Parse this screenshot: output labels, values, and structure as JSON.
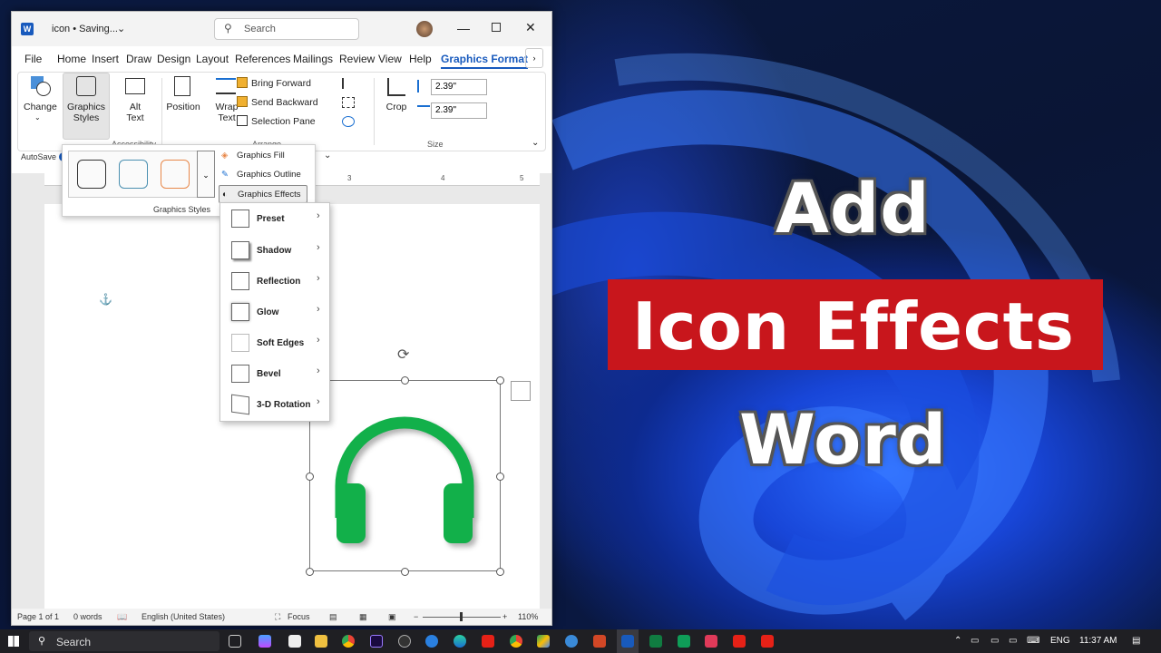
{
  "window": {
    "title": "icon • Saving...",
    "search_placeholder": "Search"
  },
  "tabs": [
    "File",
    "Home",
    "Insert",
    "Draw",
    "Design",
    "Layout",
    "References",
    "Mailings",
    "Review",
    "View",
    "Help",
    "Graphics Format"
  ],
  "ribbon": {
    "change": "Change",
    "graphics_styles": "Graphics Styles",
    "alt_text": "Alt Text",
    "accessibility": "Accessibility",
    "position": "Position",
    "wrap_text": "Wrap Text",
    "bring_forward": "Bring Forward",
    "send_backward": "Send Backward",
    "selection_pane": "Selection Pane",
    "arrange": "Arrange",
    "crop": "Crop",
    "height": "2.39\"",
    "width": "2.39\"",
    "size": "Size"
  },
  "qat": {
    "autosave": "AutoSave"
  },
  "gallery": {
    "label": "Graphics Styles",
    "fill": "Graphics Fill",
    "outline": "Graphics Outline",
    "effects": "Graphics Effects",
    "swatch_colors": [
      "#333333",
      "#4a8fb0",
      "#e8884a"
    ]
  },
  "effects_menu": [
    "Preset",
    "Shadow",
    "Reflection",
    "Glow",
    "Soft Edges",
    "Bevel",
    "3-D Rotation"
  ],
  "ruler": [
    "3",
    "4",
    "5"
  ],
  "icon_color": "#12b04a",
  "statusbar": {
    "page": "Page 1 of 1",
    "words": "0 words",
    "language": "English (United States)",
    "focus": "Focus",
    "zoom": "110%"
  },
  "headline": {
    "line1": "Add",
    "line2": "Icon Effects",
    "line3": "Word",
    "banner_color": "#c8161c"
  },
  "taskbar": {
    "search": "Search",
    "lang": "ENG",
    "time": "11:37 AM"
  }
}
